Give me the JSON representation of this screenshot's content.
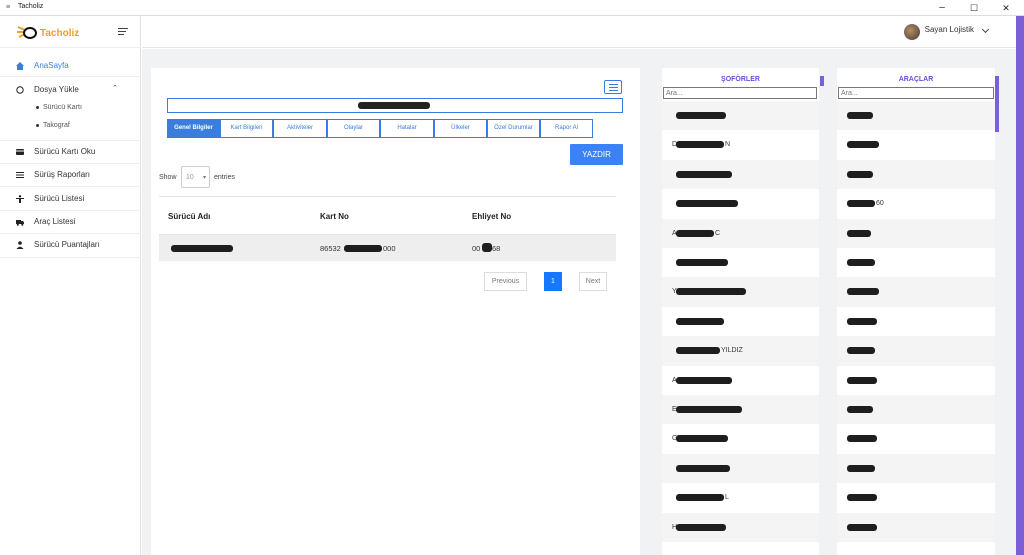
{
  "window": {
    "title": "Tacholiz",
    "app_icon": "tachometer-icon",
    "controls": [
      "–",
      "☐",
      "✕"
    ]
  },
  "brand": {
    "name": "Tacholiz",
    "brand_color": "#e8a02b"
  },
  "user": {
    "name": "Sayan Lojistik"
  },
  "sidebar": {
    "items": [
      {
        "label": "AnaSayfa",
        "icon": "home-icon",
        "active": true
      },
      {
        "label": "Dosya Yükle",
        "icon": "circle-icon",
        "expanded": true
      },
      {
        "label": "Sürücü Kartı Oku",
        "icon": "credit-card-icon"
      },
      {
        "label": "Sürüş Raporları",
        "icon": "list-icon"
      },
      {
        "label": "Sürücü Listesi",
        "icon": "person-icon"
      },
      {
        "label": "Araç Listesi",
        "icon": "truck-icon"
      },
      {
        "label": "Sürücü Puantajları",
        "icon": "user-icon"
      }
    ],
    "subitems": [
      "Sürücü Kartı",
      "Takograf"
    ],
    "expand_icon": "chevron-up-icon"
  },
  "tabs": [
    "Genel Bilgiler",
    "Kart Bilgileri",
    "Aktiviteler",
    "Olaylar",
    "Hatalar",
    "Ülkeler",
    "Özel Durumlar",
    "Rapor Al"
  ],
  "actions": {
    "print": "YAZDIR"
  },
  "table": {
    "show_label": "Show",
    "page_size": "10",
    "entries_label": "entries",
    "headers": [
      "Sürücü Adı",
      "Kart No",
      "Ehliyet No"
    ],
    "row": {
      "name": "",
      "card_prefix": "86532",
      "card_suffix": "000",
      "license_prefix": "00",
      "license_suffix": "68"
    }
  },
  "pagination": {
    "previous": "Previous",
    "current": "1",
    "next": "Next"
  },
  "drivers_panel": {
    "title": "ŞOFÖRLER",
    "search_placeholder": "Ara...",
    "rows": [
      {
        "pre": "",
        "post": ""
      },
      {
        "pre": "D",
        "post": "N"
      },
      {
        "pre": "",
        "post": ""
      },
      {
        "pre": "",
        "post": ""
      },
      {
        "pre": "A",
        "post": "C"
      },
      {
        "pre": "",
        "post": ""
      },
      {
        "pre": "Y",
        "post": ""
      },
      {
        "pre": "",
        "post": ""
      },
      {
        "pre": "",
        "post": "YILDIZ"
      },
      {
        "pre": "A",
        "post": ""
      },
      {
        "pre": "E",
        "post": ""
      },
      {
        "pre": "G",
        "post": ""
      },
      {
        "pre": "",
        "post": ""
      },
      {
        "pre": "",
        "post": "L"
      },
      {
        "pre": "H",
        "post": ""
      }
    ]
  },
  "vehicles_panel": {
    "title": "ARAÇLAR",
    "search_placeholder": "Ara...",
    "rows": [
      {
        "pre": "",
        "post": ""
      },
      {
        "pre": "",
        "post": ""
      },
      {
        "pre": "",
        "post": ""
      },
      {
        "pre": "",
        "post": "60"
      },
      {
        "pre": "",
        "post": ""
      },
      {
        "pre": "",
        "post": ""
      },
      {
        "pre": "",
        "post": ""
      },
      {
        "pre": "",
        "post": ""
      },
      {
        "pre": "",
        "post": ""
      },
      {
        "pre": "",
        "post": ""
      },
      {
        "pre": "",
        "post": ""
      },
      {
        "pre": "",
        "post": ""
      },
      {
        "pre": "",
        "post": ""
      },
      {
        "pre": "",
        "post": ""
      },
      {
        "pre": "",
        "post": ""
      }
    ]
  },
  "colors": {
    "accent": "#3b7ddd",
    "panel_title": "#6a4fd6",
    "scroll_accent": "#7b5fd6",
    "page_active": "#1677ff"
  }
}
